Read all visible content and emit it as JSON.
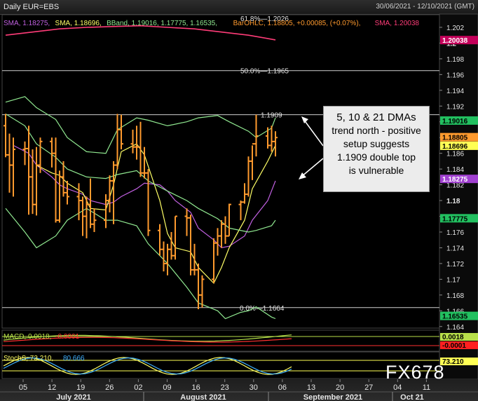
{
  "header": {
    "title": "Daily EUR=EBS",
    "date_range": "30/06/2021 - 12/10/2021 (GMT)"
  },
  "legend": {
    "main": [
      {
        "text": "SMA, 1.18275,",
        "color": "#c060e0"
      },
      {
        "text": "SMA, 1.18696,",
        "color": "#ffff66"
      },
      {
        "text": "BBand, 1.19016, 1.17775, 1.16535,",
        "color": "#90e890"
      },
      {
        "text": "BarOHLC, 1.18805, +0.00085, (+0.07%),",
        "color": "#ff9a2e"
      },
      {
        "text": "SMA, 1.20038",
        "color": "#ff3c78"
      }
    ],
    "macd": [
      {
        "text": "MACD, 0.0018,",
        "color": "#b8e04a"
      },
      {
        "text": "-0.0001",
        "color": "#ff3030"
      }
    ],
    "stoch": [
      {
        "text": "StochS, 73.210,",
        "color": "#ffff66"
      },
      {
        "text": "80.666",
        "color": "#3fb0ff"
      }
    ]
  },
  "annotations": {
    "fib_top": "61.8%—1.2026",
    "fib_50": "50.0%—1.1965",
    "fib_0": "0.0%—1.1664",
    "double_top": "1.1909",
    "callout": [
      "5, 10 & 21 DMAs",
      "trend north - positive",
      "setup suggests",
      "1.1909 double top",
      "is vulnerable"
    ]
  },
  "brand": "FX678",
  "x_axis": {
    "day_ticks": [
      "05",
      "12",
      "19",
      "26",
      "02",
      "09",
      "16",
      "23",
      "30",
      "06",
      "13",
      "20",
      "27",
      "04",
      "11"
    ],
    "months": [
      "July 2021",
      "August 2021",
      "September 2021",
      "Oct 21"
    ]
  },
  "price_axis": {
    "ticks": [
      "1.202",
      "1.2",
      "1.198",
      "1.196",
      "1.194",
      "1.192",
      "1.19",
      "1.188",
      "1.186",
      "1.184",
      "1.182",
      "1.18",
      "1.178",
      "1.176",
      "1.174",
      "1.172",
      "1.17",
      "1.168",
      "1.166",
      "1.164"
    ],
    "badges": [
      {
        "label": "1.20038",
        "value": 1.20038,
        "bg": "#c4005a",
        "fg": "#ffffff"
      },
      {
        "label": "1.19016",
        "value": 1.19016,
        "bg": "#22c060",
        "fg": "#000000"
      },
      {
        "label": "1.18805",
        "value": 1.18805,
        "bg": "#ff9a2e",
        "fg": "#000000"
      },
      {
        "label": "1.18696",
        "value": 1.18696,
        "bg": "#ffff55",
        "fg": "#000000"
      },
      {
        "label": "1.18275",
        "value": 1.18275,
        "bg": "#a040d0",
        "fg": "#ffffff"
      },
      {
        "label": "1.17775",
        "value": 1.17775,
        "bg": "#22c060",
        "fg": "#000000"
      },
      {
        "label": "1.16535",
        "value": 1.16535,
        "bg": "#22c060",
        "fg": "#000000"
      }
    ]
  },
  "macd_axis": {
    "badges": [
      {
        "label": "0.0018",
        "bg": "#b8e04a",
        "fg": "#000000"
      },
      {
        "label": "-0.0001",
        "bg": "#ff2020",
        "fg": "#000000"
      }
    ]
  },
  "stoch_axis": {
    "badges": [
      {
        "label": "73.210",
        "bg": "#ffff55",
        "fg": "#000000"
      }
    ]
  },
  "chart_data": {
    "type": "bar",
    "title": "Daily EUR=EBS",
    "ylim": [
      1.1638,
      1.2036
    ],
    "x_start": "2021-06-30",
    "x_end": "2021-10-12",
    "ohlc": [
      {
        "d": "2021-06-30",
        "o": 1.1895,
        "h": 1.191,
        "l": 1.1855,
        "c": 1.1858
      },
      {
        "d": "2021-07-01",
        "o": 1.1858,
        "h": 1.1885,
        "l": 1.181,
        "c": 1.1845
      },
      {
        "d": "2021-07-02",
        "o": 1.1845,
        "h": 1.188,
        "l": 1.1805,
        "c": 1.1865
      },
      {
        "d": "2021-07-05",
        "o": 1.1865,
        "h": 1.1875,
        "l": 1.1845,
        "c": 1.1866
      },
      {
        "d": "2021-07-06",
        "o": 1.1866,
        "h": 1.1895,
        "l": 1.1782,
        "c": 1.183
      },
      {
        "d": "2021-07-07",
        "o": 1.183,
        "h": 1.1865,
        "l": 1.1783,
        "c": 1.1795
      },
      {
        "d": "2021-07-08",
        "o": 1.1795,
        "h": 1.1868,
        "l": 1.1781,
        "c": 1.1845
      },
      {
        "d": "2021-07-09",
        "o": 1.1845,
        "h": 1.188,
        "l": 1.1835,
        "c": 1.1875
      },
      {
        "d": "2021-07-12",
        "o": 1.1875,
        "h": 1.188,
        "l": 1.1842,
        "c": 1.186
      },
      {
        "d": "2021-07-13",
        "o": 1.186,
        "h": 1.188,
        "l": 1.1772,
        "c": 1.1775
      },
      {
        "d": "2021-07-14",
        "o": 1.1775,
        "h": 1.1838,
        "l": 1.1772,
        "c": 1.183
      },
      {
        "d": "2021-07-15",
        "o": 1.183,
        "h": 1.185,
        "l": 1.1805,
        "c": 1.181
      },
      {
        "d": "2021-07-16",
        "o": 1.181,
        "h": 1.1825,
        "l": 1.1795,
        "c": 1.1805
      },
      {
        "d": "2021-07-19",
        "o": 1.1805,
        "h": 1.1822,
        "l": 1.1775,
        "c": 1.18
      },
      {
        "d": "2021-07-20",
        "o": 1.18,
        "h": 1.1805,
        "l": 1.1755,
        "c": 1.178
      },
      {
        "d": "2021-07-21",
        "o": 1.178,
        "h": 1.1805,
        "l": 1.1752,
        "c": 1.1795
      },
      {
        "d": "2021-07-22",
        "o": 1.1795,
        "h": 1.1828,
        "l": 1.1765,
        "c": 1.177
      },
      {
        "d": "2021-07-23",
        "o": 1.177,
        "h": 1.179,
        "l": 1.176,
        "c": 1.1775
      },
      {
        "d": "2021-07-26",
        "o": 1.1775,
        "h": 1.1808,
        "l": 1.1765,
        "c": 1.18
      },
      {
        "d": "2021-07-27",
        "o": 1.18,
        "h": 1.1832,
        "l": 1.1785,
        "c": 1.1825
      },
      {
        "d": "2021-07-28",
        "o": 1.1825,
        "h": 1.185,
        "l": 1.177,
        "c": 1.1845
      },
      {
        "d": "2021-07-29",
        "o": 1.1845,
        "h": 1.191,
        "l": 1.184,
        "c": 1.189
      },
      {
        "d": "2021-07-30",
        "o": 1.189,
        "h": 1.1909,
        "l": 1.1865,
        "c": 1.1872
      },
      {
        "d": "2021-08-02",
        "o": 1.1872,
        "h": 1.189,
        "l": 1.186,
        "c": 1.1868
      },
      {
        "d": "2021-08-03",
        "o": 1.1868,
        "h": 1.1895,
        "l": 1.1852,
        "c": 1.1868
      },
      {
        "d": "2021-08-04",
        "o": 1.1868,
        "h": 1.19,
        "l": 1.183,
        "c": 1.1835
      },
      {
        "d": "2021-08-05",
        "o": 1.1835,
        "h": 1.1868,
        "l": 1.1828,
        "c": 1.1835
      },
      {
        "d": "2021-08-06",
        "o": 1.1835,
        "h": 1.184,
        "l": 1.1755,
        "c": 1.1762
      },
      {
        "d": "2021-08-09",
        "o": 1.1762,
        "h": 1.177,
        "l": 1.173,
        "c": 1.1738
      },
      {
        "d": "2021-08-10",
        "o": 1.1738,
        "h": 1.1748,
        "l": 1.171,
        "c": 1.172
      },
      {
        "d": "2021-08-11",
        "o": 1.172,
        "h": 1.1745,
        "l": 1.1705,
        "c": 1.1738
      },
      {
        "d": "2021-08-12",
        "o": 1.1738,
        "h": 1.176,
        "l": 1.1725,
        "c": 1.173
      },
      {
        "d": "2021-08-13",
        "o": 1.173,
        "h": 1.178,
        "l": 1.1725,
        "c": 1.178
      },
      {
        "d": "2021-08-16",
        "o": 1.178,
        "h": 1.179,
        "l": 1.1755,
        "c": 1.1778
      },
      {
        "d": "2021-08-17",
        "o": 1.1778,
        "h": 1.1782,
        "l": 1.1705,
        "c": 1.1712
      },
      {
        "d": "2021-08-18",
        "o": 1.1712,
        "h": 1.1745,
        "l": 1.1705,
        "c": 1.1712
      },
      {
        "d": "2021-08-19",
        "o": 1.1712,
        "h": 1.172,
        "l": 1.1662,
        "c": 1.168
      },
      {
        "d": "2021-08-20",
        "o": 1.168,
        "h": 1.1705,
        "l": 1.1664,
        "c": 1.17
      },
      {
        "d": "2021-08-23",
        "o": 1.17,
        "h": 1.1752,
        "l": 1.1695,
        "c": 1.1746
      },
      {
        "d": "2021-08-24",
        "o": 1.1746,
        "h": 1.1765,
        "l": 1.173,
        "c": 1.1755
      },
      {
        "d": "2021-08-25",
        "o": 1.1755,
        "h": 1.1775,
        "l": 1.174,
        "c": 1.177
      },
      {
        "d": "2021-08-26",
        "o": 1.177,
        "h": 1.178,
        "l": 1.1745,
        "c": 1.1755
      },
      {
        "d": "2021-08-27",
        "o": 1.1755,
        "h": 1.1796,
        "l": 1.1755,
        "c": 1.1795
      },
      {
        "d": "2021-08-30",
        "o": 1.1795,
        "h": 1.18,
        "l": 1.1775,
        "c": 1.1798
      },
      {
        "d": "2021-08-31",
        "o": 1.1798,
        "h": 1.1822,
        "l": 1.1796,
        "c": 1.1808
      },
      {
        "d": "2021-09-01",
        "o": 1.1808,
        "h": 1.1856,
        "l": 1.1805,
        "c": 1.185
      },
      {
        "d": "2021-09-02",
        "o": 1.185,
        "h": 1.187,
        "l": 1.1826,
        "c": 1.1872
      },
      {
        "d": "2021-09-03",
        "o": 1.1872,
        "h": 1.1909,
        "l": 1.1856,
        "c": 1.1882
      },
      {
        "d": "2021-09-06",
        "o": 1.1882,
        "h": 1.1893,
        "l": 1.1866,
        "c": 1.187
      },
      {
        "d": "2021-09-07",
        "o": 1.187,
        "h": 1.1895,
        "l": 1.1862,
        "c": 1.1875
      },
      {
        "d": "2021-09-08",
        "o": 1.1875,
        "h": 1.1888,
        "l": 1.1856,
        "c": 1.188
      }
    ],
    "series": [
      {
        "name": "SMA 1.18275",
        "color": "#c060e0",
        "values": [
          [
            2,
            1.187
          ],
          [
            4,
            1.186
          ],
          [
            6,
            1.1845
          ],
          [
            8,
            1.183
          ],
          [
            10,
            1.182
          ],
          [
            12,
            1.1815
          ],
          [
            14,
            1.1808
          ],
          [
            16,
            1.18
          ],
          [
            18,
            1.1795
          ],
          [
            20,
            1.1798
          ],
          [
            22,
            1.1805
          ],
          [
            24,
            1.1815
          ],
          [
            26,
            1.1822
          ],
          [
            28,
            1.182
          ],
          [
            30,
            1.1812
          ],
          [
            32,
            1.18
          ],
          [
            34,
            1.1785
          ],
          [
            36,
            1.1765
          ],
          [
            38,
            1.175
          ],
          [
            40,
            1.174
          ],
          [
            42,
            1.1742
          ],
          [
            44,
            1.1755
          ],
          [
            46,
            1.1775
          ],
          [
            48,
            1.18
          ],
          [
            50,
            1.1825
          ]
        ]
      },
      {
        "name": "SMA 1.18696",
        "color": "#ffff66",
        "values": [
          [
            6,
            1.1845
          ],
          [
            8,
            1.1835
          ],
          [
            10,
            1.1832
          ],
          [
            12,
            1.1822
          ],
          [
            14,
            1.181
          ],
          [
            16,
            1.179
          ],
          [
            18,
            1.1788
          ],
          [
            20,
            1.182
          ],
          [
            22,
            1.1862
          ],
          [
            24,
            1.1872
          ],
          [
            26,
            1.1858
          ],
          [
            28,
            1.18
          ],
          [
            30,
            1.1758
          ],
          [
            32,
            1.174
          ],
          [
            34,
            1.1735
          ],
          [
            36,
            1.1715
          ],
          [
            38,
            1.1695
          ],
          [
            40,
            1.1715
          ],
          [
            42,
            1.174
          ],
          [
            44,
            1.1775
          ],
          [
            46,
            1.1815
          ],
          [
            48,
            1.185
          ],
          [
            50,
            1.187
          ]
        ]
      },
      {
        "name": "BBand upper 1.19016",
        "color": "#90e890",
        "values": [
          [
            0,
            1.1925
          ],
          [
            3,
            1.1932
          ],
          [
            6,
            1.1918
          ],
          [
            9,
            1.1903
          ],
          [
            12,
            1.188
          ],
          [
            15,
            1.1862
          ],
          [
            18,
            1.186
          ],
          [
            21,
            1.189
          ],
          [
            24,
            1.1905
          ],
          [
            27,
            1.1902
          ],
          [
            30,
            1.1895
          ],
          [
            33,
            1.19
          ],
          [
            36,
            1.1905
          ],
          [
            39,
            1.1908
          ],
          [
            42,
            1.19
          ],
          [
            45,
            1.1888
          ],
          [
            47,
            1.188
          ],
          [
            49,
            1.1892
          ],
          [
            50,
            1.1905
          ]
        ]
      },
      {
        "name": "BBand middle 1.17775",
        "color": "#90e890",
        "values": [
          [
            0,
            1.191
          ],
          [
            3,
            1.1895
          ],
          [
            6,
            1.1872
          ],
          [
            9,
            1.1855
          ],
          [
            12,
            1.184
          ],
          [
            15,
            1.183
          ],
          [
            18,
            1.1828
          ],
          [
            21,
            1.1833
          ],
          [
            24,
            1.1838
          ],
          [
            27,
            1.1825
          ],
          [
            30,
            1.1812
          ],
          [
            33,
            1.18
          ],
          [
            36,
            1.179
          ],
          [
            39,
            1.1777
          ],
          [
            42,
            1.1765
          ],
          [
            45,
            1.176
          ],
          [
            47,
            1.1762
          ],
          [
            49,
            1.1768
          ],
          [
            50,
            1.1775
          ]
        ]
      },
      {
        "name": "BBand lower 1.16535",
        "color": "#90e890",
        "values": [
          [
            0,
            1.179
          ],
          [
            3,
            1.176
          ],
          [
            6,
            1.174
          ],
          [
            9,
            1.1755
          ],
          [
            12,
            1.1775
          ],
          [
            15,
            1.179
          ],
          [
            18,
            1.1775
          ],
          [
            21,
            1.1775
          ],
          [
            24,
            1.1768
          ],
          [
            27,
            1.1745
          ],
          [
            30,
            1.172
          ],
          [
            33,
            1.169
          ],
          [
            36,
            1.167
          ],
          [
            39,
            1.166
          ],
          [
            41,
            1.165
          ],
          [
            43,
            1.1658
          ],
          [
            45,
            1.166
          ],
          [
            47,
            1.1665
          ],
          [
            49,
            1.1652
          ],
          [
            50,
            1.165
          ]
        ]
      },
      {
        "name": "SMA 1.20038",
        "color": "#ff3c78",
        "values": [
          [
            0,
            1.201
          ],
          [
            5,
            1.2014
          ],
          [
            10,
            1.2018
          ],
          [
            15,
            1.202
          ],
          [
            20,
            1.2021
          ],
          [
            25,
            1.2022
          ],
          [
            30,
            1.202
          ],
          [
            35,
            1.2018
          ],
          [
            40,
            1.2014
          ],
          [
            45,
            1.201
          ],
          [
            50,
            1.2004
          ]
        ]
      }
    ],
    "hlines": [
      {
        "label": "50.0%—1.1965",
        "value": 1.1965
      },
      {
        "label": "0.0%—1.1664",
        "value": 1.1664
      },
      {
        "label": "1.1909",
        "value": 1.1909
      }
    ]
  }
}
